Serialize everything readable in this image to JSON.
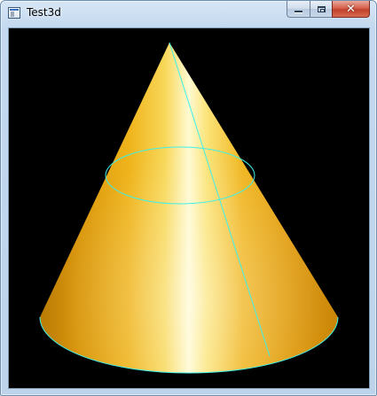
{
  "window": {
    "title": "Test3d",
    "icon": "application-window-icon"
  },
  "caption_buttons": {
    "minimize": "minimize-icon",
    "maximize": "maximize-icon",
    "close": "close-icon"
  },
  "scene": {
    "object": "cone",
    "background_color": "#000000",
    "surface_color": "#e8a818",
    "highlight_color": "#fffbd0",
    "edge_color": "#3ef0e8"
  }
}
